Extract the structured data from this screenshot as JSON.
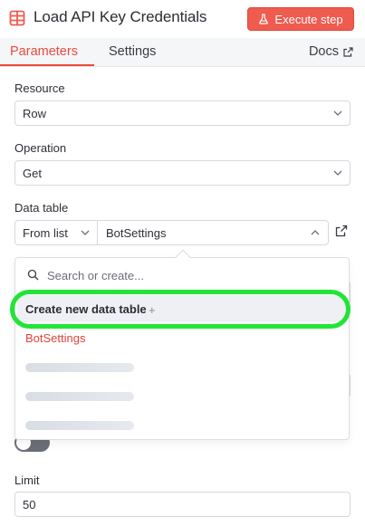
{
  "header": {
    "title": "Load API Key Credentials",
    "execute_label": "Execute step",
    "node_icon": "table-icon",
    "accent_color": "#ef5b4f"
  },
  "tabs": {
    "items": [
      {
        "label": "Parameters",
        "active": true
      },
      {
        "label": "Settings",
        "active": false
      }
    ],
    "docs_label": "Docs"
  },
  "form": {
    "resource": {
      "label": "Resource",
      "value": "Row"
    },
    "operation": {
      "label": "Operation",
      "value": "Get"
    },
    "data_table": {
      "label": "Data table",
      "mode": "From list",
      "value": "BotSettings"
    },
    "limit": {
      "label": "Limit",
      "value": "50"
    }
  },
  "dropdown": {
    "search_placeholder": "Search or create...",
    "create_label": "Create new data table",
    "create_icon": "+",
    "options": [
      "BotSettings"
    ],
    "loading_placeholders": 3
  },
  "toggle": {
    "state": "off"
  }
}
